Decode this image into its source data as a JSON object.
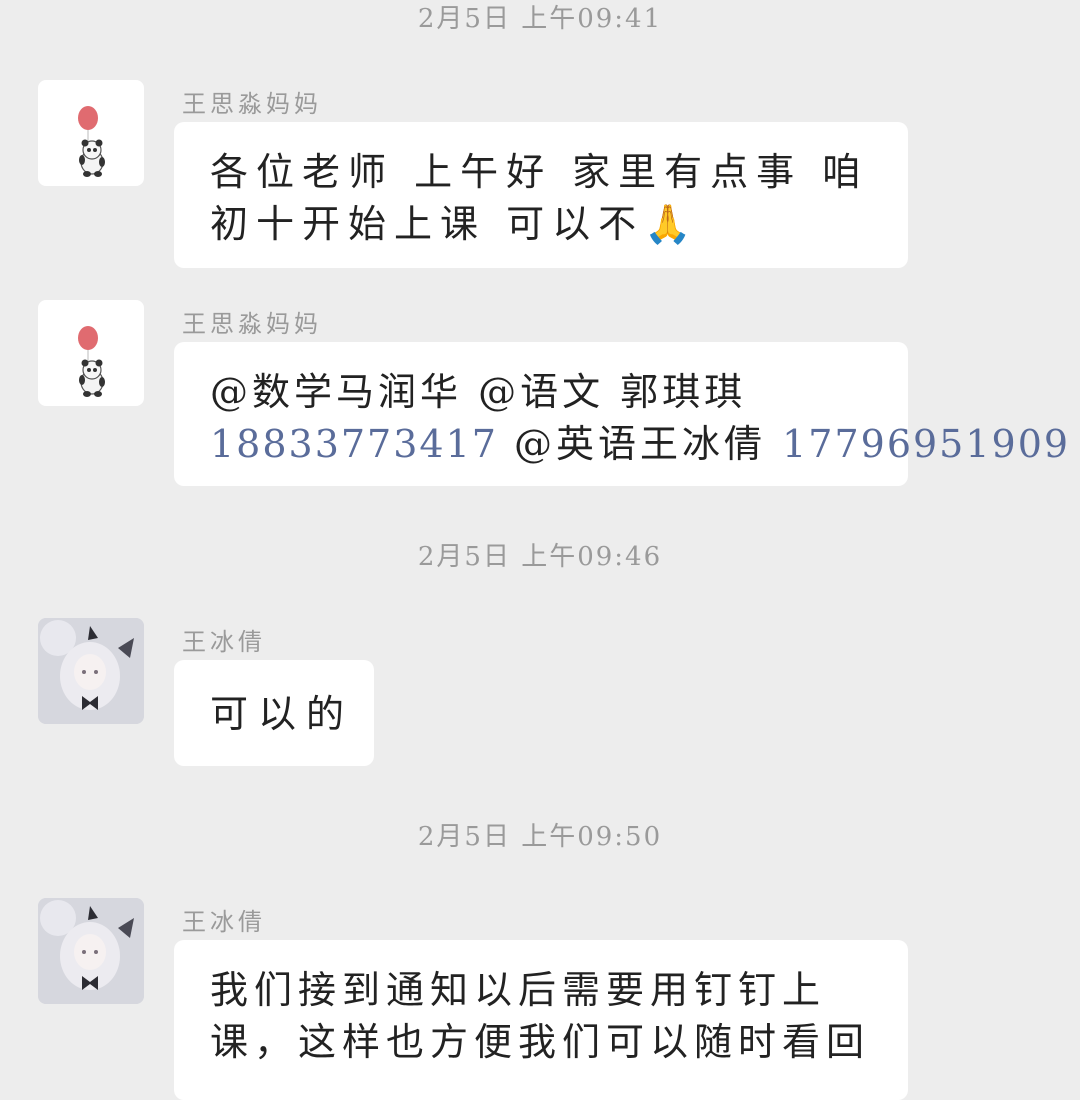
{
  "messages": [
    {
      "timestamp": "2月5日 上午09:41",
      "sender": "王思淼妈妈",
      "avatar": "panda-balloon-avatar",
      "lines": [
        "各位老师 上午好  家里有点事 咱",
        "初十开始上课  可以不"
      ],
      "emoji": "🙏"
    },
    {
      "sender": "王思淼妈妈",
      "avatar": "panda-balloon-avatar",
      "line1": "@数学马润华 @语文  郭琪琪",
      "phone1": "18833773417",
      "mention": " @英语王冰倩 ",
      "phone2": "17796951909"
    },
    {
      "timestamp": "2月5日 上午09:46",
      "sender": "王冰倩",
      "avatar": "anime-girl-avatar",
      "text": "可以的"
    },
    {
      "timestamp": "2月5日 上午09:50",
      "sender": "王冰倩",
      "avatar": "anime-girl-avatar",
      "lines": [
        "我们接到通知以后需要用钉钉上",
        "课，这样也方便我们可以随时看回"
      ]
    }
  ],
  "colors": {
    "background": "#ededed",
    "bubble": "#ffffff",
    "phone_link": "#5a6c9a",
    "meta_text": "#9a9a9a"
  }
}
